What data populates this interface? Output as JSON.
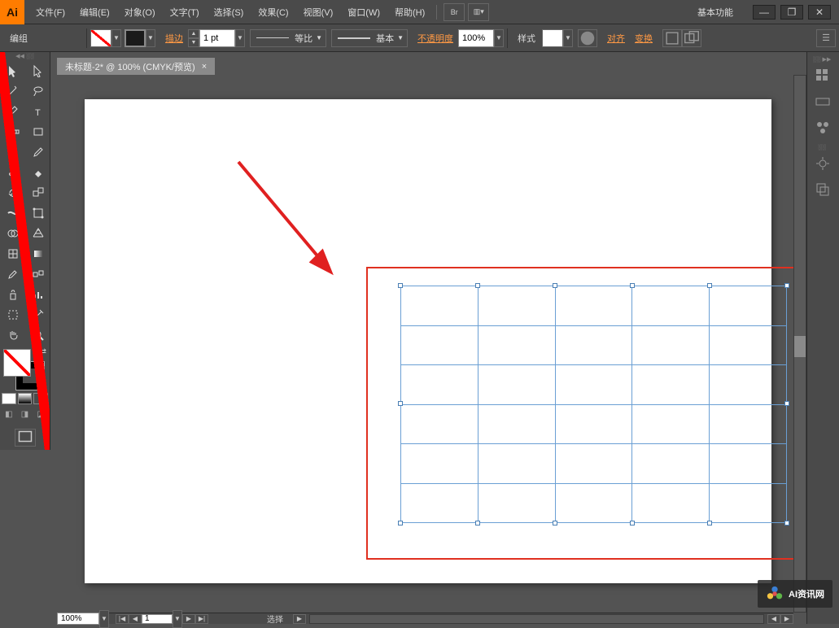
{
  "app_logo": "Ai",
  "menu": [
    "文件(F)",
    "编辑(E)",
    "对象(O)",
    "文字(T)",
    "选择(S)",
    "效果(C)",
    "视图(V)",
    "窗口(W)",
    "帮助(H)"
  ],
  "aux_buttons": {
    "br": "Br",
    "arrange": "▥▾"
  },
  "workspace_label": "基本功能",
  "window_btns": {
    "min": "—",
    "max": "❐",
    "close": "✕"
  },
  "control": {
    "mode_label": "编组",
    "stroke_label": "描边",
    "stroke_weight": "1 pt",
    "profile_label": "等比",
    "style_brush_label": "基本",
    "opacity_label": "不透明度",
    "opacity_value": "100%",
    "style_label": "样式",
    "align_label": "对齐",
    "transform_label": "变换"
  },
  "tab": {
    "title": "未标题-2* @ 100% (CMYK/预览)",
    "close": "×"
  },
  "colors": {
    "white": "#ffffff",
    "black": "#000000"
  },
  "status": {
    "zoom": "100%",
    "page": "1",
    "mode": "选择"
  },
  "watermark": "AI资讯网",
  "grid": {
    "rows": 6,
    "cols": 5
  }
}
